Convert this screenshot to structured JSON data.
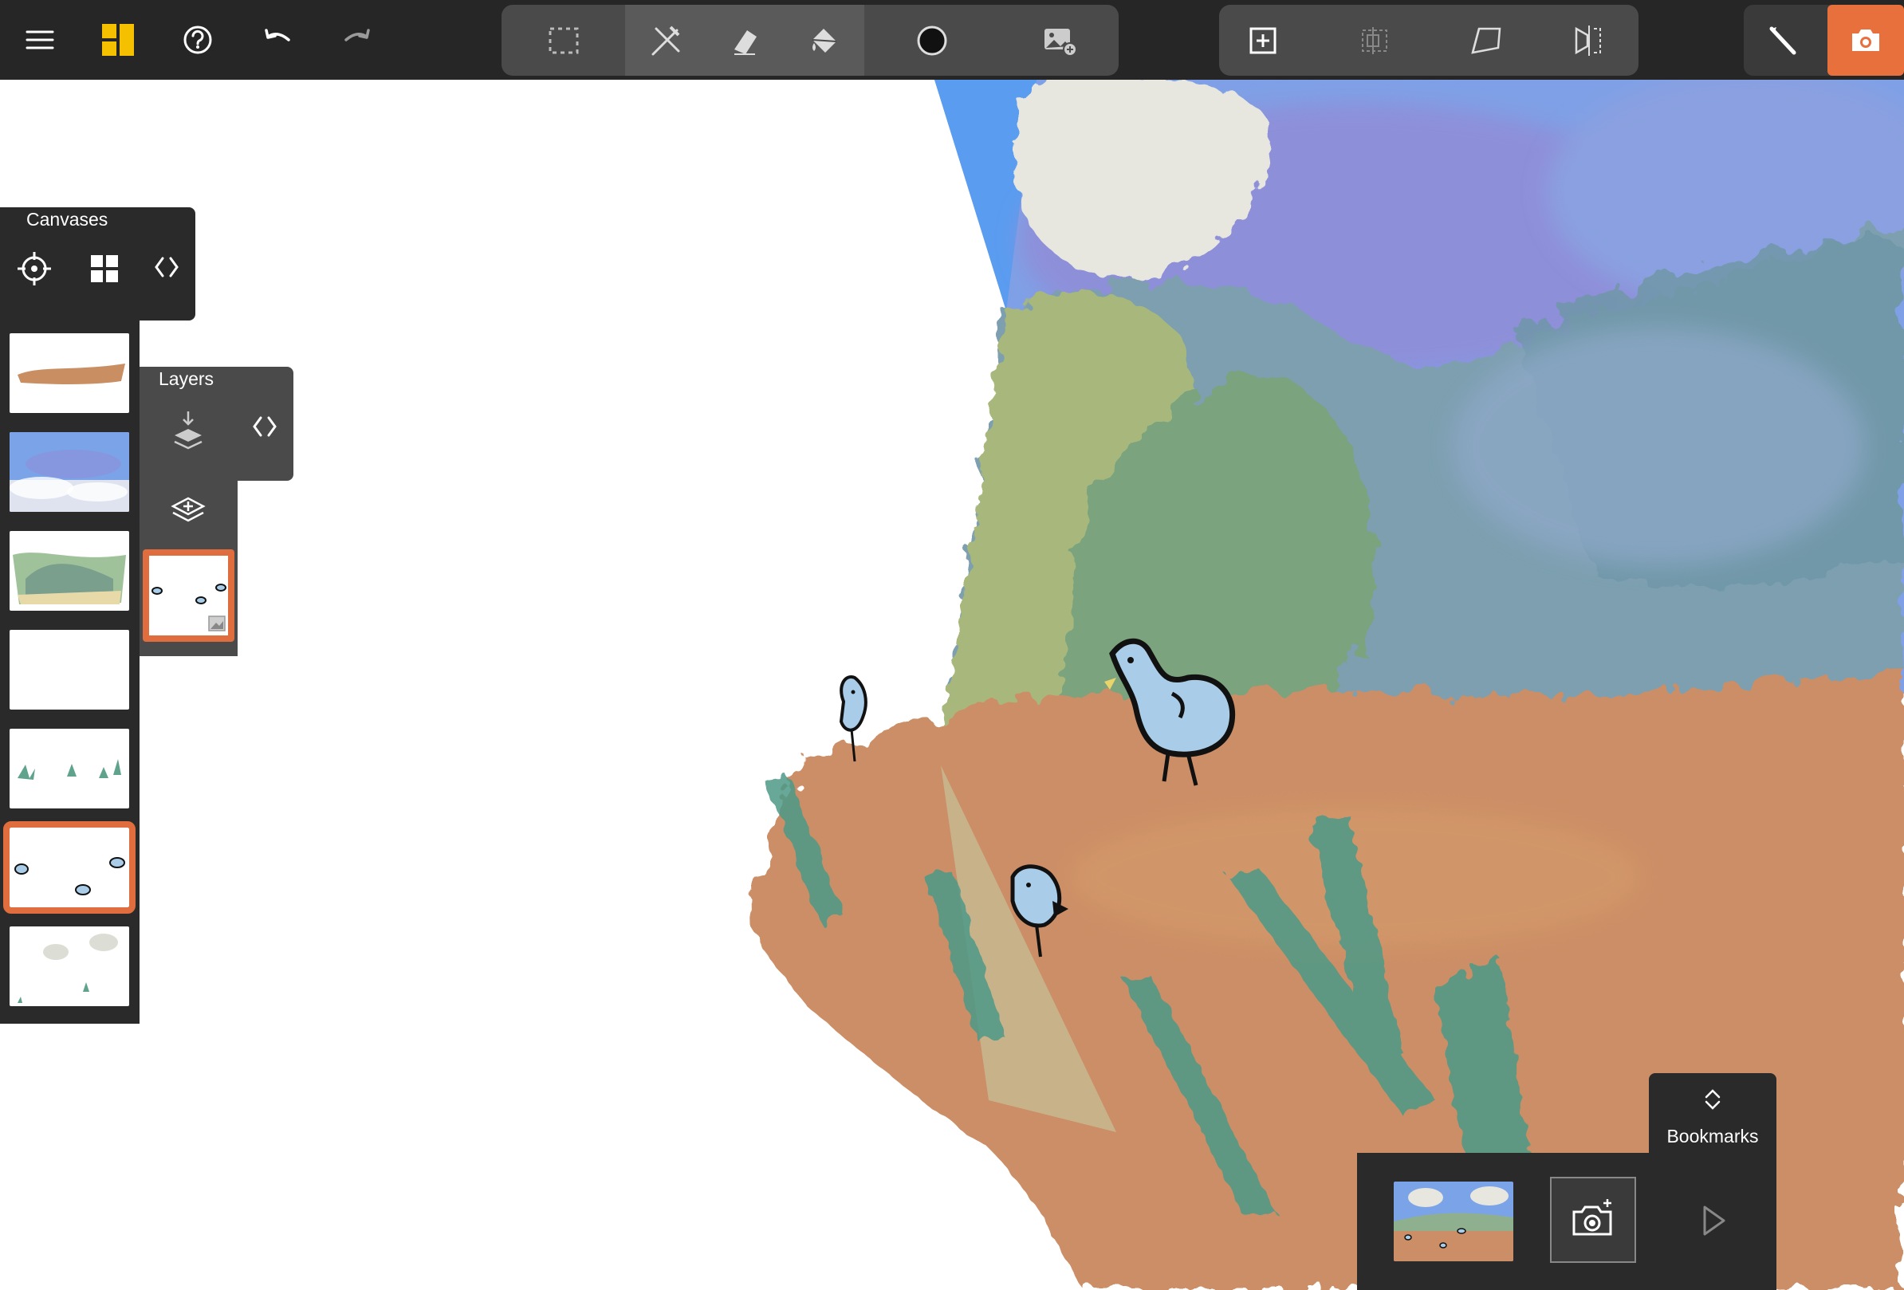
{
  "app": {
    "colors": {
      "toolbar_bg": "#262626",
      "accent": "#e8703c",
      "panel_bg": "#2a2a2a",
      "logo_yellow": "#f5c000"
    }
  },
  "toolbar": {
    "left_icons": [
      "menu-icon",
      "app-logo-icon",
      "help-icon",
      "undo-icon",
      "redo-icon"
    ],
    "tools": [
      "marquee-select-icon",
      "brush-pen-icon",
      "eraser-icon",
      "fill-bucket-icon",
      "brush-size-icon",
      "add-image-icon"
    ],
    "transform_tools": [
      "add-canvas-icon",
      "crop-icon",
      "perspective-icon",
      "flip-icon"
    ],
    "right_icons": [
      "stroke-tool-icon",
      "camera-icon"
    ]
  },
  "canvases_panel": {
    "title": "Canvases",
    "icons": [
      "target-icon",
      "grid-icon",
      "collapse-icon"
    ],
    "thumbnails": [
      {
        "name": "ground-strip"
      },
      {
        "name": "sky-clouds"
      },
      {
        "name": "green-hills"
      },
      {
        "name": "blank"
      },
      {
        "name": "grass-tufts"
      },
      {
        "name": "birds",
        "selected": true
      },
      {
        "name": "clouds-sprouts"
      }
    ]
  },
  "layers_panel": {
    "title": "Layers",
    "icons": [
      "merge-down-icon",
      "collapse-icon",
      "add-layer-icon"
    ],
    "selected_layer": "birds-layer"
  },
  "bookmarks": {
    "label": "Bookmarks",
    "icons": [
      "chevron-updown-icon",
      "add-bookmark-camera-icon",
      "play-icon"
    ]
  }
}
